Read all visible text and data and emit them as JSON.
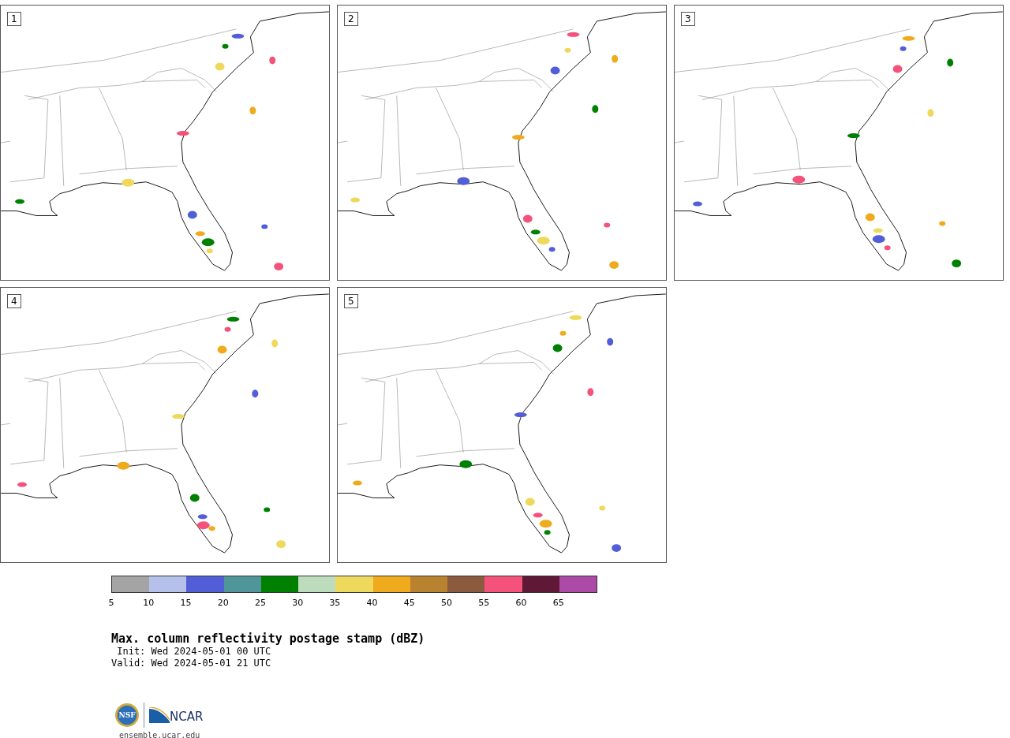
{
  "panels": [
    {
      "label": "1"
    },
    {
      "label": "2"
    },
    {
      "label": "3"
    },
    {
      "label": "4"
    },
    {
      "label": "5"
    }
  ],
  "colorbar": {
    "segments": [
      {
        "color": "#a4a4a4"
      },
      {
        "color": "#b6c1eb"
      },
      {
        "color": "#525ed7"
      },
      {
        "color": "#4f959a"
      },
      {
        "color": "#008000"
      },
      {
        "color": "#bddcbc"
      },
      {
        "color": "#efd95c"
      },
      {
        "color": "#efab1c"
      },
      {
        "color": "#b9822f"
      },
      {
        "color": "#8c5a3f"
      },
      {
        "color": "#f4527a"
      },
      {
        "color": "#5f1836"
      },
      {
        "color": "#ac4ba7"
      }
    ],
    "ticks": [
      "5",
      "10",
      "15",
      "20",
      "25",
      "30",
      "35",
      "40",
      "45",
      "50",
      "55",
      "60",
      "65"
    ]
  },
  "title": "Max. column reflectivity postage stamp (dBZ)",
  "init": " Init: Wed 2024-05-01 00 UTC",
  "valid": "Valid: Wed 2024-05-01 21 UTC",
  "logo": {
    "nsf": "NSF",
    "ncar": "NCAR"
  },
  "footer": "ensemble.ucar.edu"
}
